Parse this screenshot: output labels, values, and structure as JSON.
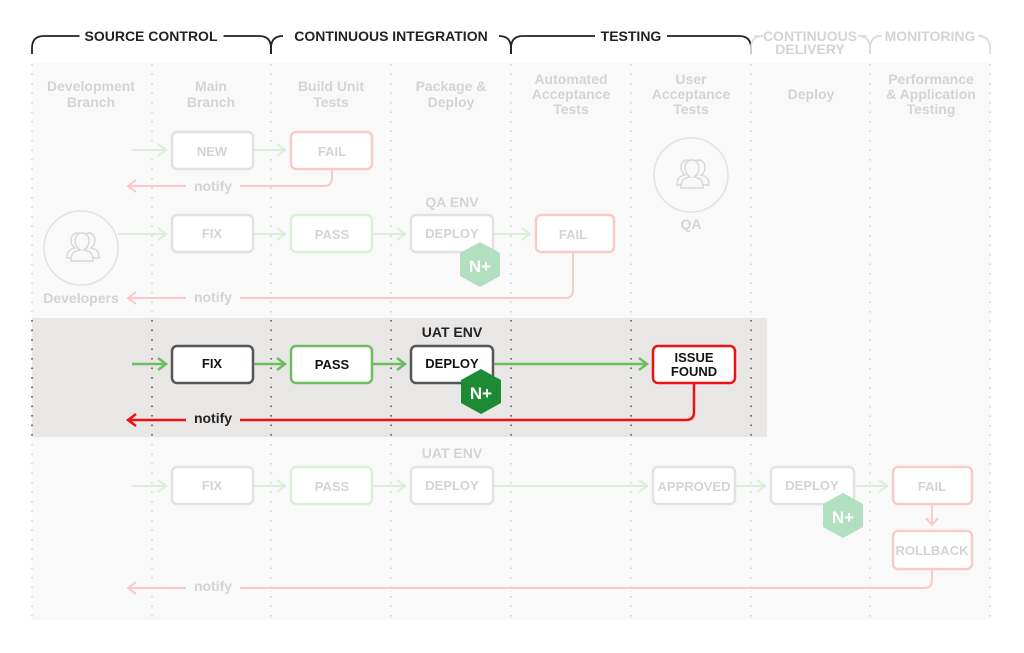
{
  "phases": [
    {
      "label": "SOURCE CONTROL",
      "active": true
    },
    {
      "label": "CONTINUOUS INTEGRATION",
      "active": true
    },
    {
      "label": "TESTING",
      "active": true
    },
    {
      "label": "CONTINUOUS DELIVERY",
      "lines": [
        "CONTINUOUS",
        "DELIVERY"
      ],
      "active": false
    },
    {
      "label": "MONITORING",
      "active": false
    }
  ],
  "columns": [
    {
      "lines": [
        "Development",
        "Branch"
      ]
    },
    {
      "lines": [
        "Main",
        "Branch"
      ]
    },
    {
      "lines": [
        "Build Unit",
        "Tests"
      ]
    },
    {
      "lines": [
        "Package &",
        "Deploy"
      ]
    },
    {
      "lines": [
        "Automated",
        "Acceptance",
        "Tests"
      ]
    },
    {
      "lines": [
        "User",
        "Acceptance",
        "Tests"
      ]
    },
    {
      "lines": [
        "Deploy"
      ]
    },
    {
      "lines": [
        "Performance",
        "& Application",
        "Testing"
      ]
    }
  ],
  "actors": {
    "developers": {
      "label": "Developers",
      "icon": "group-users-icon"
    },
    "qa": {
      "label": "QA",
      "icon": "group-users-icon"
    }
  },
  "rows": {
    "row1": {
      "new": "NEW",
      "fail": "FAIL",
      "notify": "notify"
    },
    "row2": {
      "env": "QA ENV",
      "fix": "FIX",
      "pass": "PASS",
      "deploy": "DEPLOY",
      "fail": "FAIL",
      "notify": "notify",
      "badge": "N+"
    },
    "row3": {
      "env": "UAT ENV",
      "fix": "FIX",
      "pass": "PASS",
      "deploy": "DEPLOY",
      "issue": [
        "ISSUE",
        "FOUND"
      ],
      "notify": "notify",
      "badge": "N+",
      "highlighted": true
    },
    "row4": {
      "env": "UAT ENV",
      "fix": "FIX",
      "pass": "PASS",
      "deploy": "DEPLOY",
      "approved": "APPROVED",
      "deploy2": "DEPLOY",
      "fail": "FAIL",
      "rollback": "ROLLBACK",
      "notify": "notify",
      "badge": "N+"
    }
  },
  "colors": {
    "dark": "#222222",
    "faded_text": "#d4d4d4",
    "green": "#6cbd5f",
    "green_faded": "#dcefd8",
    "red": "#ee1111",
    "red_faded": "#fbc9c9",
    "nginx_green": "#1d8a34",
    "nginx_faded": "#b2dfbf",
    "highlight_bg": "#e8e7e6",
    "panel_bg": "#f9f9f9"
  }
}
